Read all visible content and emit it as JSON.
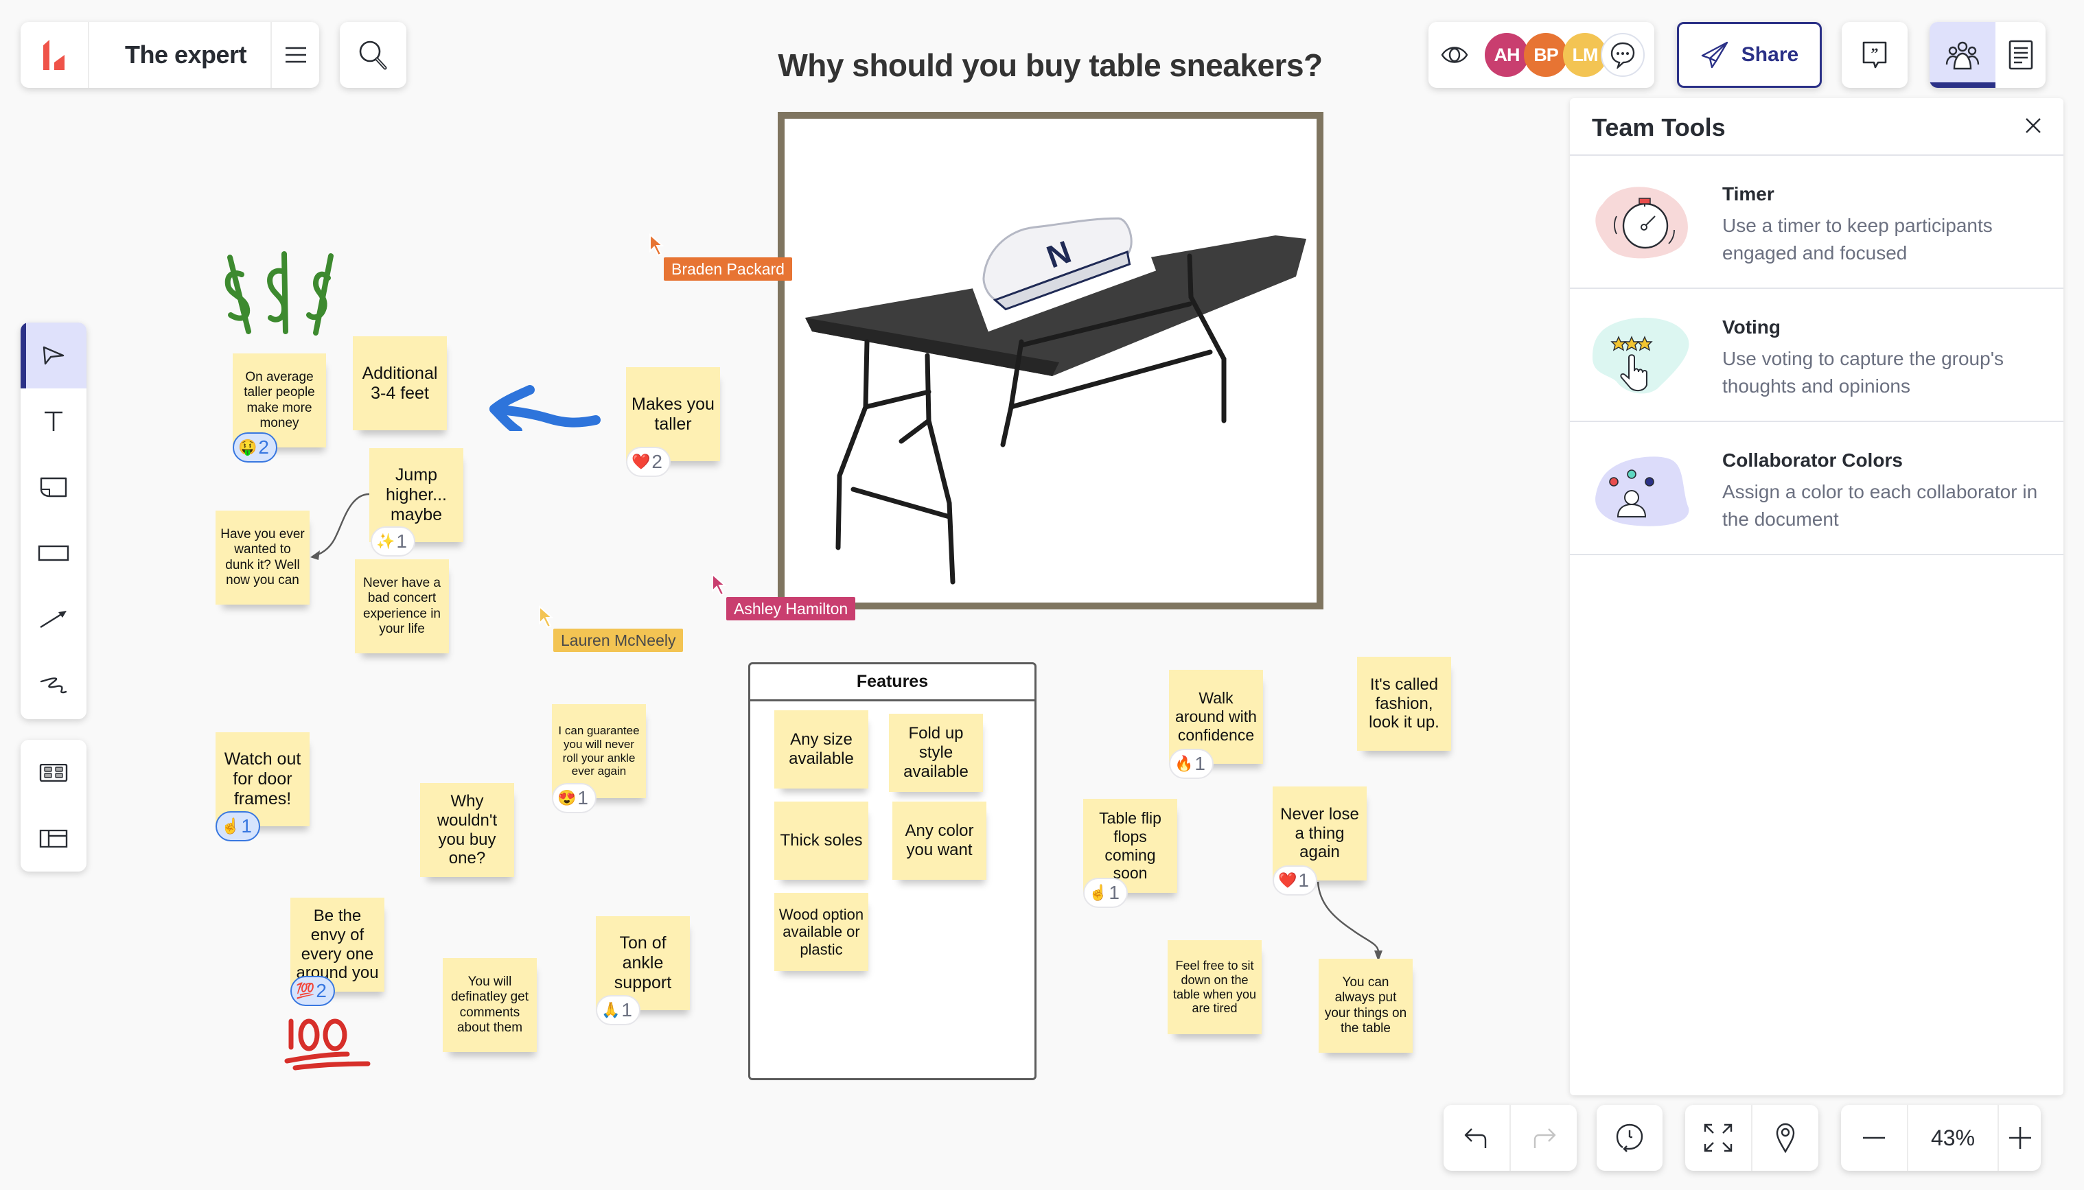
{
  "app": {
    "document_title": "The expert",
    "board_title": "Why should you buy table sneakers?"
  },
  "header": {
    "share_label": "Share",
    "collaborators": [
      {
        "initials": "AH",
        "name": "Ashley Hamilton",
        "color": "#c93e6f"
      },
      {
        "initials": "BP",
        "name": "Braden Packard",
        "color": "#e77433"
      },
      {
        "initials": "LM",
        "name": "Lauren McNeely",
        "color": "#f3c453"
      }
    ]
  },
  "team_tools": {
    "title": "Team Tools",
    "tools": [
      {
        "name": "Timer",
        "description": "Use a timer to keep participants engaged and focused"
      },
      {
        "name": "Voting",
        "description": "Use voting to capture the group's thoughts and opinions"
      },
      {
        "name": "Collaborator Colors",
        "description": "Assign a color to each collaborator in the document"
      }
    ]
  },
  "left_toolbar": {
    "tools": [
      "select",
      "text",
      "sticky-note",
      "rectangle",
      "line",
      "freehand-draw"
    ],
    "active": "select",
    "extras": [
      "templates",
      "layout"
    ]
  },
  "bottom_controls": {
    "zoom_level": "43%"
  },
  "cursors": [
    {
      "name": "Braden Packard",
      "color": "#e77433"
    },
    {
      "name": "Ashley Hamilton",
      "color": "#c93e6f"
    },
    {
      "name": "Lauren McNeely",
      "color": "#f3c453"
    }
  ],
  "stickies": [
    {
      "text": "On average taller people make more money",
      "reaction": {
        "emoji": "🤑",
        "count": "2",
        "mine": true
      }
    },
    {
      "text": "Additional 3-4 feet"
    },
    {
      "text": "Makes you taller",
      "reaction": {
        "emoji": "❤️",
        "count": "2",
        "mine": false
      }
    },
    {
      "text": "Jump higher... maybe",
      "reaction": {
        "emoji": "✨",
        "count": "1",
        "mine": false
      }
    },
    {
      "text": "Have you ever wanted to dunk it? Well now you can"
    },
    {
      "text": "Never have a bad concert experience in your life"
    },
    {
      "text": "Watch out for door frames!",
      "reaction": {
        "emoji": "☝️",
        "count": "1",
        "mine": true
      }
    },
    {
      "text": "Why wouldn't you buy one?"
    },
    {
      "text": "I can guarantee you will never roll your ankle ever again",
      "reaction": {
        "emoji": "😍",
        "count": "1",
        "mine": false
      }
    },
    {
      "text": "Be the envy of every one around you",
      "reaction": {
        "emoji": "💯",
        "count": "2",
        "mine": true
      }
    },
    {
      "text": "You will definatley get comments about them"
    },
    {
      "text": "Ton of ankle support",
      "reaction": {
        "emoji": "🙏",
        "count": "1",
        "mine": false
      }
    },
    {
      "text": "Walk around with confidence",
      "reaction": {
        "emoji": "🔥",
        "count": "1",
        "mine": false
      }
    },
    {
      "text": "It's called fashion, look it up."
    },
    {
      "text": "Table flip flops coming soon",
      "reaction": {
        "emoji": "☝️",
        "count": "1",
        "mine": false
      }
    },
    {
      "text": "Never lose a thing again",
      "reaction": {
        "emoji": "❤️",
        "count": "1",
        "mine": false
      }
    },
    {
      "text": "Feel free to sit down on the table when you are tired"
    },
    {
      "text": "You can always put your things on the table"
    }
  ],
  "features_container": {
    "title": "Features",
    "items": [
      "Any size available",
      "Fold up style available",
      "Thick soles",
      "Any color you want",
      "Wood option available or plastic"
    ]
  },
  "drawings": {
    "dollar_signs": "$$$",
    "hundred": "100"
  },
  "image": {
    "description": "Folding table with sneaker on top"
  }
}
